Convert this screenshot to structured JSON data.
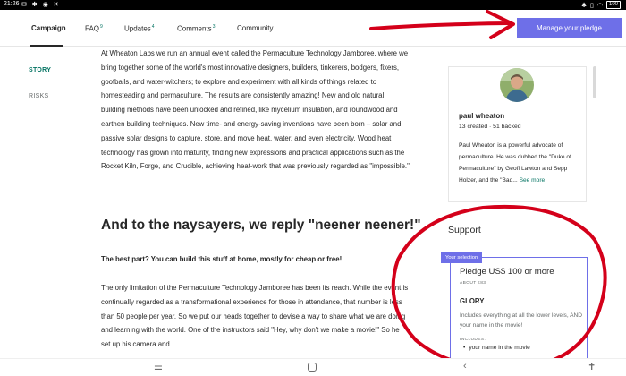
{
  "status_bar": {
    "time": "21:26",
    "icons": [
      "notification-icon",
      "bluetooth-icon",
      "android-icon",
      "x-icon"
    ],
    "right_icons": [
      "bluetooth-icon",
      "vibrate-icon",
      "wifi-icon"
    ],
    "battery": "100"
  },
  "nav": {
    "tabs": [
      {
        "label": "Campaign",
        "count": ""
      },
      {
        "label": "FAQ",
        "count": "9"
      },
      {
        "label": "Updates",
        "count": "4"
      },
      {
        "label": "Comments",
        "count": "3"
      },
      {
        "label": "Community",
        "count": ""
      }
    ],
    "pledge_button": "Manage your pledge"
  },
  "side_nav": {
    "story": "STORY",
    "risks": "RISKS"
  },
  "article": {
    "paragraph1": "At Wheaton Labs we run an annual event called the Permaculture Technology Jamboree, where we bring together some of the world's most innovative designers, builders, tinkerers, bodgers, fixers, goofballs, and water-witchers; to explore and experiment with all kinds of things related to homesteading and permaculture.  The results are consistently amazing!  New and old natural building methods have been unlocked and refined, like mycelium insulation, and roundwood and earthen building techniques.  New time- and energy-saving inventions have been born – solar and passive solar designs to capture, store, and move heat, water, and even electricity. Wood heat technology has grown into maturity, finding new expressions and practical applications such as the Rocket Kiln, Forge, and Crucible, achieving heat-work that was previously regarded as \"impossible.\"",
    "heading": "And to the naysayers, we reply \"neener neener!\"",
    "subheading": "The best part? You can build this stuff at home, mostly for cheap or free!",
    "paragraph2": "The only limitation of the Permaculture Technology Jamboree has been its reach.  While the event is continually regarded as a transformational experience for those in attendance, that number is less than 50 people per year.  So we put our heads together to devise a way to share what we are doing and learning with the world.  One of the instructors said \"Hey, why don't we make a movie!\"  So he set up his camera and"
  },
  "creator": {
    "name": "paul wheaton",
    "stats": "13 created · 51 backed",
    "bio": "Paul Wheaton is a powerful advocate of permaculture. He was dubbed the \"Duke of Permaculture\" by Geoff Lawton and Sepp Holzer, and the \"Bad...",
    "see_more": "See more"
  },
  "support": {
    "title": "Support",
    "badge": "Your selection",
    "amount": "Pledge US$ 100 or more",
    "about": "ABOUT £83",
    "reward_name": "GLORY",
    "description": "Includes everything at all the lower levels, AND your name in the movie!",
    "includes_label": "INCLUDES:",
    "includes": [
      "your name in the movie"
    ]
  },
  "colors": {
    "accent": "#037362",
    "button": "#6e6fe8",
    "annotation": "#d4001a"
  }
}
